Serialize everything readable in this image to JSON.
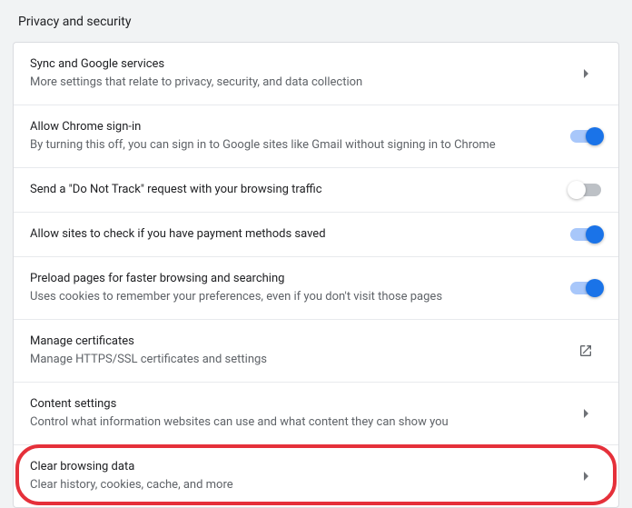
{
  "section_title": "Privacy and security",
  "rows": [
    {
      "title": "Sync and Google services",
      "subtitle": "More settings that relate to privacy, security, and data collection",
      "control": "chevron"
    },
    {
      "title": "Allow Chrome sign-in",
      "subtitle": "By turning this off, you can sign in to Google sites like Gmail without signing in to Chrome",
      "control": "toggle-on"
    },
    {
      "title": "Send a \"Do Not Track\" request with your browsing traffic",
      "subtitle": "",
      "control": "toggle-off"
    },
    {
      "title": "Allow sites to check if you have payment methods saved",
      "subtitle": "",
      "control": "toggle-on"
    },
    {
      "title": "Preload pages for faster browsing and searching",
      "subtitle": "Uses cookies to remember your preferences, even if you don't visit those pages",
      "control": "toggle-on"
    },
    {
      "title": "Manage certificates",
      "subtitle": "Manage HTTPS/SSL certificates and settings",
      "control": "external"
    },
    {
      "title": "Content settings",
      "subtitle": "Control what information websites can use and what content they can show you",
      "control": "chevron"
    },
    {
      "title": "Clear browsing data",
      "subtitle": "Clear history, cookies, cache, and more",
      "control": "chevron",
      "highlighted": true
    }
  ]
}
